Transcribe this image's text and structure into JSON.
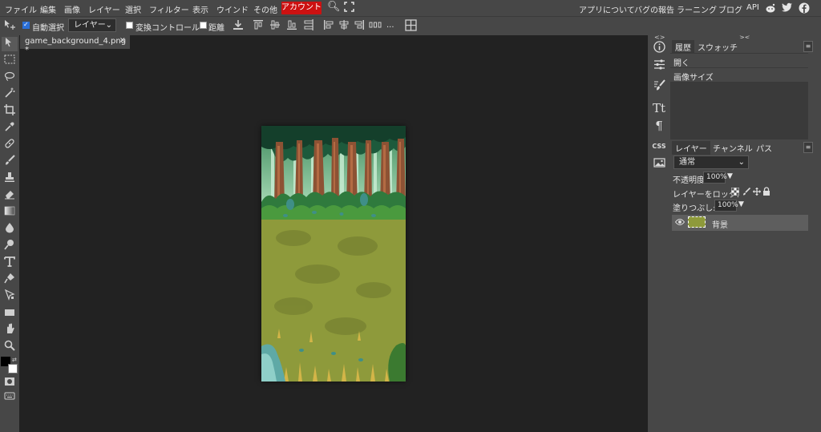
{
  "menu": {
    "items": [
      "ファイル",
      "編集",
      "画像",
      "レイヤー",
      "選択",
      "フィルター",
      "表示",
      "ウインド",
      "その他"
    ],
    "account": "アカウント",
    "right_links": [
      "アプリについて",
      "バグの報告",
      "ラーニング",
      "ブログ",
      "API"
    ]
  },
  "options": {
    "auto_select": "自動選択",
    "auto_select_checked": true,
    "layer_select": "レイヤー",
    "transform_controls": "変換コントロール",
    "distance": "距離",
    "ellipsis": "..."
  },
  "document": {
    "tab_title": "game_background_4.png *",
    "close": "✕"
  },
  "panels": {
    "history_tab": "履歴",
    "swatches_tab": "スウォッチ",
    "history_items": [
      "開く",
      "画像サイズ"
    ],
    "layers_tab": "レイヤー",
    "channels_tab": "チャンネル",
    "paths_tab": "パス",
    "blend_mode": "通常",
    "opacity_label": "不透明度:",
    "opacity_value": "100%",
    "lock_label": "レイヤーをロック:",
    "fill_label": "塗りつぶし:",
    "fill_value": "100%",
    "layer_name": "背景",
    "css_label": "CSS",
    "collapse_left": "<>",
    "collapse_right": "><"
  },
  "colors": {
    "account": "#cc1111",
    "foreground": "#000000",
    "background": "#ffffff"
  }
}
